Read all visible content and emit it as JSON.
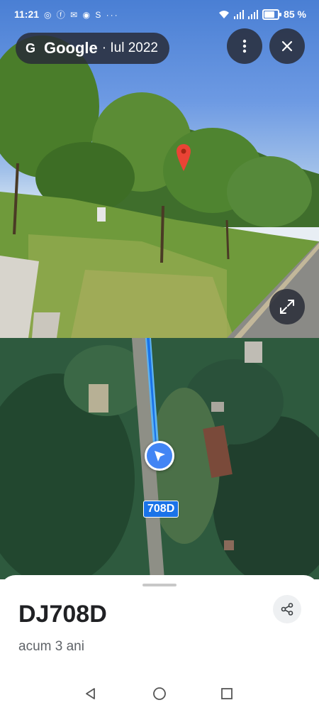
{
  "status_bar": {
    "time": "11:21",
    "notifications": "◎ ⓕ ✉ ◉ S ···",
    "battery": "85 %",
    "battery_level": 0.85
  },
  "header": {
    "brand": "Google",
    "date": "· Iul 2022",
    "g_logo": "G"
  },
  "map": {
    "road_label": "708D"
  },
  "place": {
    "title": "DJ708D",
    "subtitle": "acum 3 ani"
  },
  "colors": {
    "accent": "#1a73e8",
    "location": "#4285f4",
    "pin": "#ea4335"
  },
  "icons": {
    "more": "more-vert-icon",
    "close": "close-icon",
    "expand": "expand-icon",
    "share": "share-icon",
    "back": "back-icon",
    "home": "home-icon",
    "recents": "recents-icon"
  }
}
